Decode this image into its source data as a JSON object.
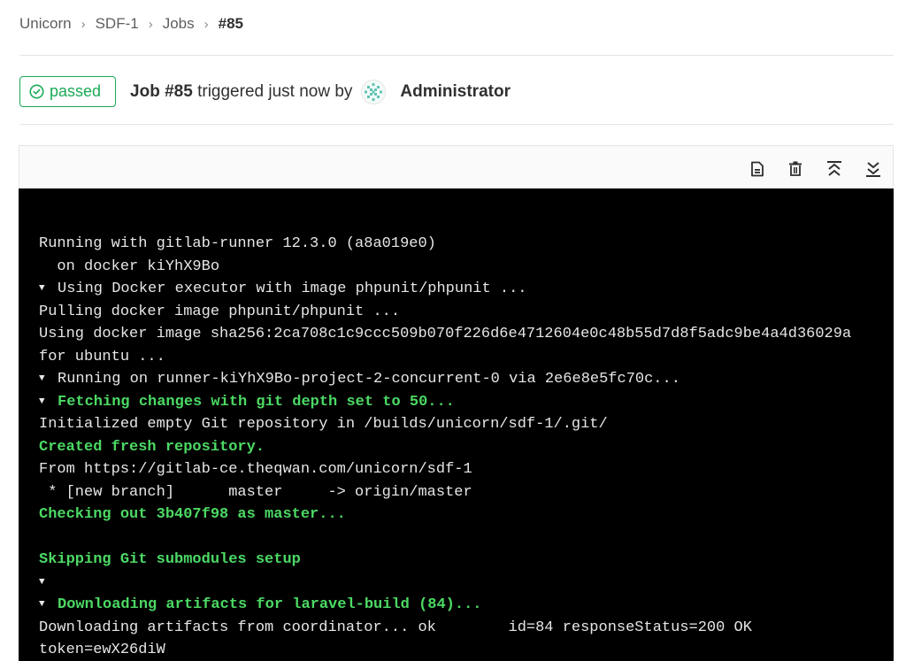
{
  "breadcrumb": {
    "items": [
      "Unicorn",
      "SDF-1",
      "Jobs"
    ],
    "current": "#85"
  },
  "status": {
    "label": "passed",
    "color": "#1aaa55"
  },
  "job": {
    "id": "Job #85",
    "trigger_text": " triggered just now by",
    "user": "Administrator"
  },
  "toolbar": {
    "icons": [
      "raw-log-icon",
      "erase-log-icon",
      "scroll-top-icon",
      "scroll-bottom-icon"
    ]
  },
  "log": {
    "lines": [
      {
        "text": "Running with gitlab-runner 12.3.0 (a8a019e0)",
        "style": "normal",
        "toggle": false
      },
      {
        "text": "  on docker kiYhX9Bo",
        "style": "normal",
        "toggle": false
      },
      {
        "text": "Using Docker executor with image phpunit/phpunit ...",
        "style": "normal",
        "toggle": true
      },
      {
        "text": "Pulling docker image phpunit/phpunit ...",
        "style": "normal",
        "toggle": false
      },
      {
        "text": "Using docker image sha256:2ca708c1c9ccc509b070f226d6e4712604e0c48b55d7d8f5adc9be4a4d36029a",
        "style": "normal",
        "toggle": false
      },
      {
        "text": "for ubuntu ...",
        "style": "normal",
        "toggle": false
      },
      {
        "text": "Running on runner-kiYhX9Bo-project-2-concurrent-0 via 2e6e8e5fc70c...",
        "style": "normal",
        "toggle": true
      },
      {
        "text": "Fetching changes with git depth set to 50...",
        "style": "green",
        "toggle": true
      },
      {
        "text": "Initialized empty Git repository in /builds/unicorn/sdf-1/.git/",
        "style": "normal",
        "toggle": false
      },
      {
        "text": "Created fresh repository.",
        "style": "green",
        "toggle": false
      },
      {
        "text": "From https://gitlab-ce.theqwan.com/unicorn/sdf-1",
        "style": "normal",
        "toggle": false
      },
      {
        "text": " * [new branch]      master     -> origin/master",
        "style": "normal",
        "toggle": false
      },
      {
        "text": "Checking out 3b407f98 as master...",
        "style": "green",
        "toggle": false
      },
      {
        "text": "",
        "style": "normal",
        "toggle": false
      },
      {
        "text": "Skipping Git submodules setup",
        "style": "green",
        "toggle": false
      },
      {
        "text": "",
        "style": "normal",
        "toggle": true
      },
      {
        "text": "Downloading artifacts for laravel-build (84)...",
        "style": "green",
        "toggle": true
      },
      {
        "text": "Downloading artifacts from coordinator... ok        id=84 responseStatus=200 OK",
        "style": "normal",
        "toggle": false
      },
      {
        "text": "token=ewX26diW",
        "style": "normal",
        "toggle": false
      }
    ]
  }
}
